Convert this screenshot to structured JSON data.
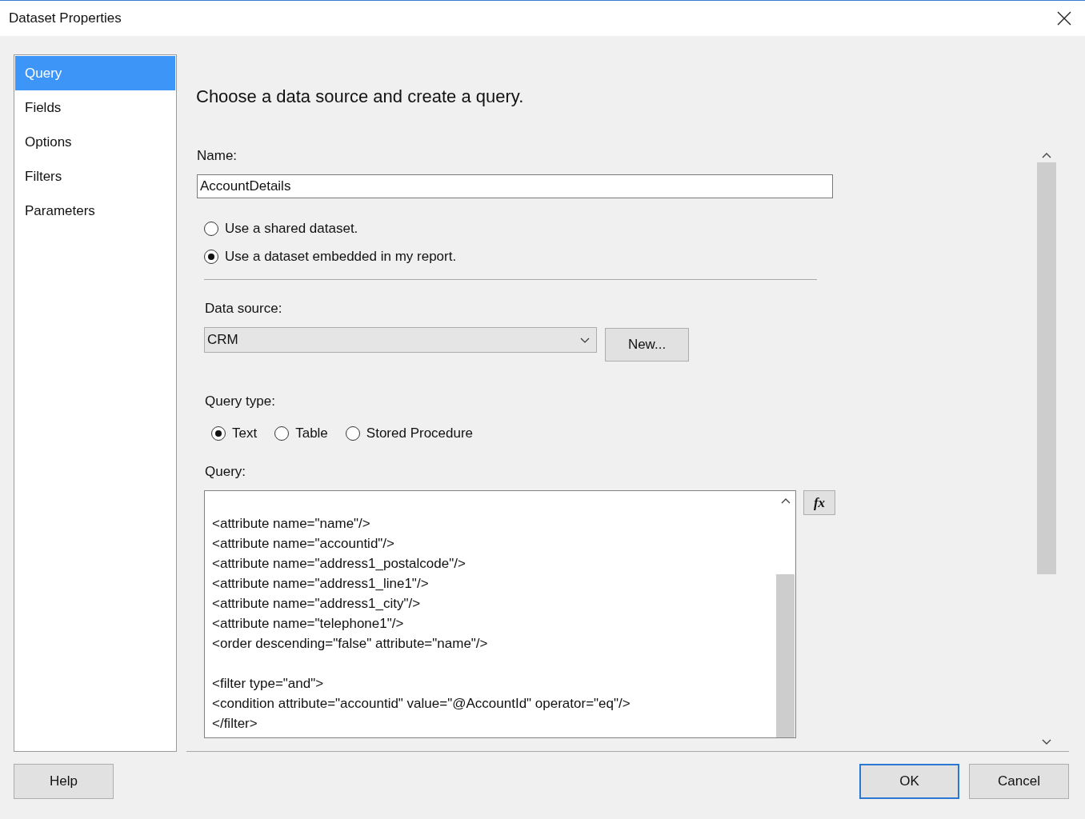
{
  "window": {
    "title": "Dataset Properties"
  },
  "nav": [
    {
      "label": "Query",
      "selected": true
    },
    {
      "label": "Fields",
      "selected": false
    },
    {
      "label": "Options",
      "selected": false
    },
    {
      "label": "Filters",
      "selected": false
    },
    {
      "label": "Parameters",
      "selected": false
    }
  ],
  "heading": "Choose a data source and create a query.",
  "name": {
    "label": "Name:",
    "value": "AccountDetails"
  },
  "dataset_options": [
    {
      "label": "Use a shared dataset.",
      "selected": false
    },
    {
      "label": "Use a dataset embedded in my report.",
      "selected": true
    }
  ],
  "data_source": {
    "label": "Data source:",
    "value": "CRM",
    "new_button": "New..."
  },
  "query_type": {
    "label": "Query type:",
    "options": [
      {
        "label": "Text",
        "selected": true
      },
      {
        "label": "Table",
        "selected": false
      },
      {
        "label": "Stored Procedure",
        "selected": false
      }
    ]
  },
  "query": {
    "label": "Query:",
    "expression_button": "fx",
    "blocks": [
      [
        "<attribute name=\"name\"/>",
        "<attribute name=\"accountid\"/>",
        "<attribute name=\"address1_postalcode\"/>",
        "<attribute name=\"address1_line1\"/>",
        "<attribute name=\"address1_city\"/>",
        "<attribute name=\"telephone1\"/>",
        "<order descending=\"false\" attribute=\"name\"/>"
      ],
      [
        "<filter type=\"and\">",
        "<condition attribute=\"accountid\" value=\"@AccountId\" operator=\"eq\"/>",
        "</filter>"
      ]
    ]
  },
  "buttons": {
    "help": "Help",
    "ok": "OK",
    "cancel": "Cancel"
  }
}
